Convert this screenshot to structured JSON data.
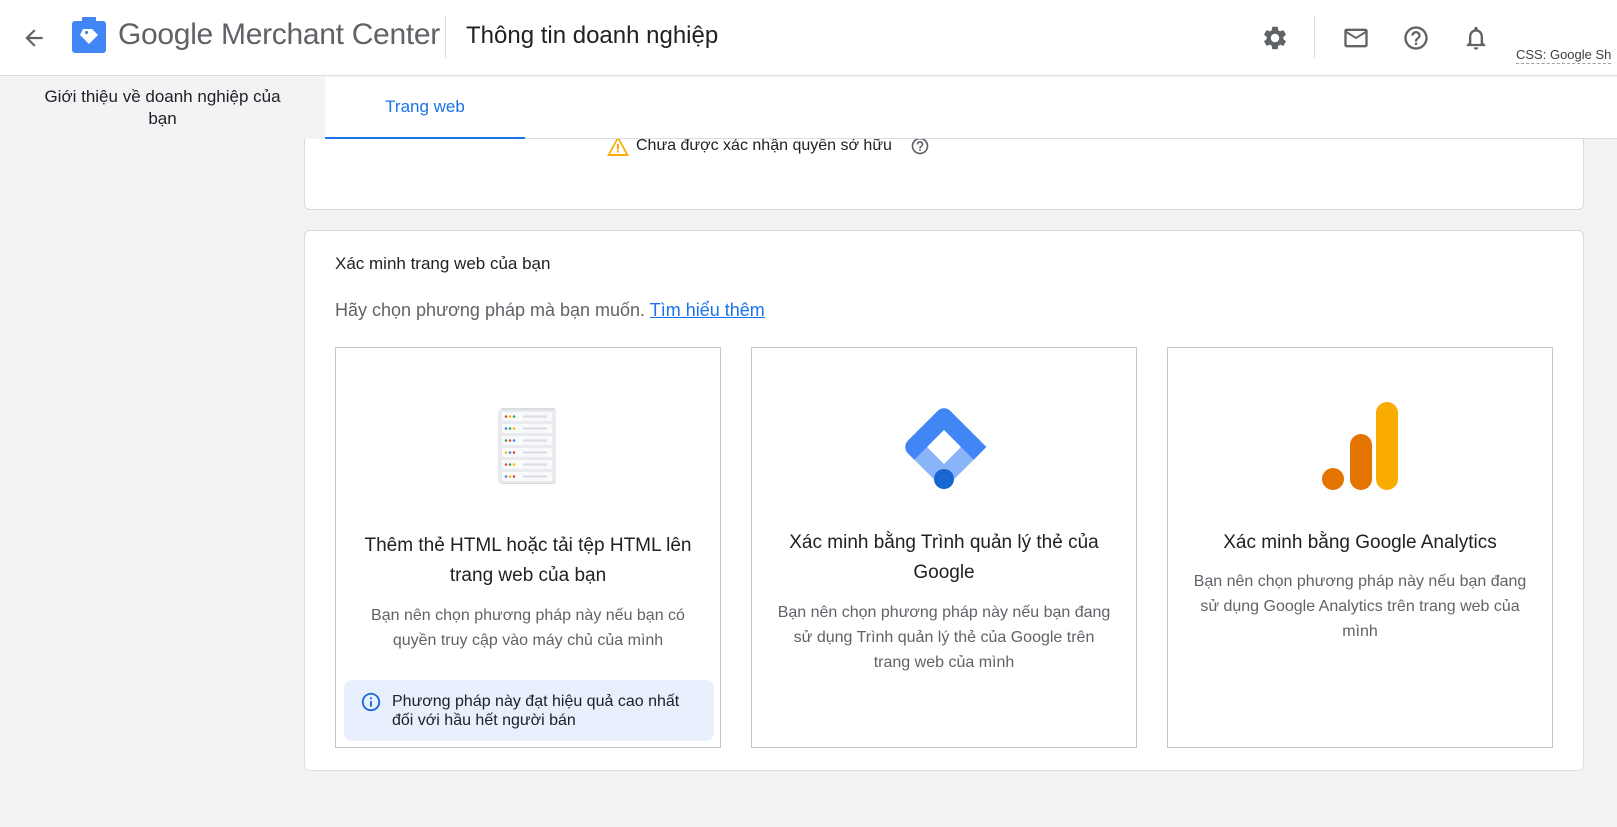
{
  "header": {
    "brand_google": "Google",
    "brand_product": "Merchant Center",
    "page_title": "Thông tin doanh nghiệp",
    "css_label": "CSS: Google Sh"
  },
  "tabs": [
    {
      "label": "Giới thiệu về doanh nghiệp của bạn"
    },
    {
      "label": "Trang web"
    }
  ],
  "website": {
    "ownership_status": "Chưa được xác nhận quyền sở hữu"
  },
  "verify": {
    "title": "Xác minh trang web của bạn",
    "subtitle": "Hãy chọn phương pháp mà bạn muốn.",
    "learn_more": "Tìm hiểu thêm",
    "options": [
      {
        "title": "Thêm thẻ HTML hoặc tải tệp HTML lên trang web của bạn",
        "description": "Bạn nên chọn phương pháp này nếu bạn có quyền truy cập vào máy chủ của mình",
        "note": "Phương pháp này đạt hiệu quả cao nhất đối với hầu hết người bán",
        "icon": "server-icon"
      },
      {
        "title": "Xác minh bằng Trình quản lý thẻ của Google",
        "description": "Bạn nên chọn phương pháp này nếu bạn đang sử dụng Trình quản lý thẻ của Google trên trang web của mình",
        "icon": "tag-manager-icon"
      },
      {
        "title": "Xác minh bằng Google Analytics",
        "description": "Bạn nên chọn phương pháp này nếu bạn đang sử dụng Google Analytics trên trang web của mình",
        "icon": "analytics-icon"
      }
    ]
  },
  "colors": {
    "accent": "#1a73e8",
    "warning": "#f9ab00",
    "info_bg": "#e8f0fe",
    "analytics_dark": "#e37400",
    "analytics_light": "#f9ab00"
  }
}
